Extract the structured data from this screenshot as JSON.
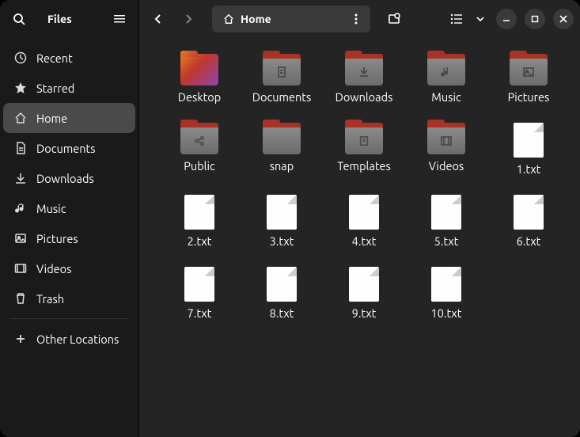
{
  "app_title": "Files",
  "path": {
    "segments": [
      {
        "label": "Home",
        "icon": "home"
      }
    ]
  },
  "sidebar": {
    "items": [
      {
        "icon": "clock",
        "label": "Recent"
      },
      {
        "icon": "star",
        "label": "Starred"
      },
      {
        "icon": "home",
        "label": "Home",
        "active": true
      },
      {
        "icon": "document",
        "label": "Documents"
      },
      {
        "icon": "download",
        "label": "Downloads"
      },
      {
        "icon": "music",
        "label": "Music"
      },
      {
        "icon": "picture",
        "label": "Pictures"
      },
      {
        "icon": "video",
        "label": "Videos"
      },
      {
        "icon": "trash",
        "label": "Trash"
      }
    ],
    "other_locations": {
      "icon": "plus",
      "label": "Other Locations"
    }
  },
  "files": [
    {
      "type": "desktop",
      "name": "Desktop"
    },
    {
      "type": "folder",
      "name": "Documents",
      "glyph": "document"
    },
    {
      "type": "folder",
      "name": "Downloads",
      "glyph": "download"
    },
    {
      "type": "folder",
      "name": "Music",
      "glyph": "music"
    },
    {
      "type": "folder",
      "name": "Pictures",
      "glyph": "picture"
    },
    {
      "type": "folder",
      "name": "Public",
      "glyph": "share"
    },
    {
      "type": "folder",
      "name": "snap",
      "glyph": ""
    },
    {
      "type": "folder",
      "name": "Templates",
      "glyph": "template"
    },
    {
      "type": "folder",
      "name": "Videos",
      "glyph": "video"
    },
    {
      "type": "file",
      "name": "1.txt"
    },
    {
      "type": "file",
      "name": "2.txt"
    },
    {
      "type": "file",
      "name": "3.txt"
    },
    {
      "type": "file",
      "name": "4.txt"
    },
    {
      "type": "file",
      "name": "5.txt"
    },
    {
      "type": "file",
      "name": "6.txt"
    },
    {
      "type": "file",
      "name": "7.txt"
    },
    {
      "type": "file",
      "name": "8.txt"
    },
    {
      "type": "file",
      "name": "9.txt"
    },
    {
      "type": "file",
      "name": "10.txt"
    }
  ]
}
